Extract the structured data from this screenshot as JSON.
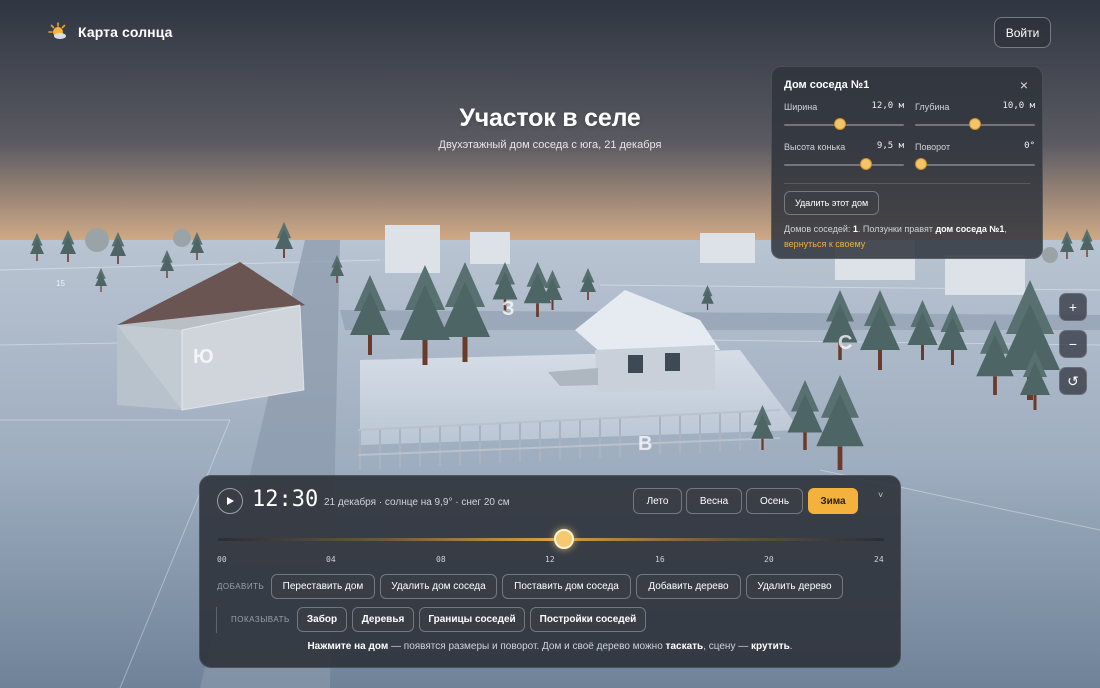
{
  "app": {
    "name": "Карта солнца",
    "login_label": "Войти"
  },
  "hero": {
    "title": "Участок в селе",
    "subtitle": "Двухэтажный дом соседа с юга, 21 декабря"
  },
  "scene": {
    "directions": {
      "south": "Ю",
      "west": "З",
      "north": "С",
      "east": "В"
    },
    "lot_number": "15"
  },
  "neighbor_panel": {
    "title": "Дом соседа №1",
    "close": "×",
    "width": {
      "label": "Ширина",
      "value": "12,0 м",
      "level": 0.47
    },
    "depth": {
      "label": "Глубина",
      "value": "10,0 м",
      "level": 0.5
    },
    "ridge": {
      "label": "Высота конька",
      "value": "9,5 м",
      "level": 0.68
    },
    "rotation": {
      "label": "Поворот",
      "value": "0°",
      "level": 0.05
    },
    "delete_label": "Удалить этот дом",
    "note": {
      "prefix": "Домов соседей: ",
      "count": "1",
      "middle": ". Ползунки правят ",
      "target": "дом соседа №1",
      "comma": ", ",
      "link": "вернуться к своему"
    }
  },
  "map_controls": {
    "zoom_in": "+",
    "zoom_out": "−",
    "reset": "↺"
  },
  "controls": {
    "time": "12:30",
    "info": "21 декабря · солнце на 9,9° · снег 20 см",
    "seasons": [
      "Лето",
      "Весна",
      "Осень",
      "Зима"
    ],
    "active_season": "Зима",
    "collapse": "˅",
    "time_level": 0.52,
    "ticks": [
      "00",
      "04",
      "08",
      "12",
      "16",
      "20",
      "24"
    ],
    "add_label": "ДОБАВИТЬ",
    "add_buttons": [
      "Переставить дом",
      "Удалить дом соседа",
      "Поставить дом соседа",
      "Добавить дерево",
      "Удалить дерево"
    ],
    "show_label": "ПОКАЗЫВАТЬ",
    "show_buttons": [
      "Забор",
      "Деревья",
      "Границы соседей",
      "Постройки соседей"
    ],
    "hint": {
      "a": "Нажмите на дом",
      "b": " — появятся размеры и поворот. Дом и своё дерево можно ",
      "c": "таскать",
      "d": ", сцену — ",
      "e": "крутить",
      "f": "."
    }
  },
  "colors": {
    "accent": "#f4b23c",
    "panel": "#30343c",
    "snow": "#c9d2df",
    "sky_glow": "#e9b888"
  }
}
